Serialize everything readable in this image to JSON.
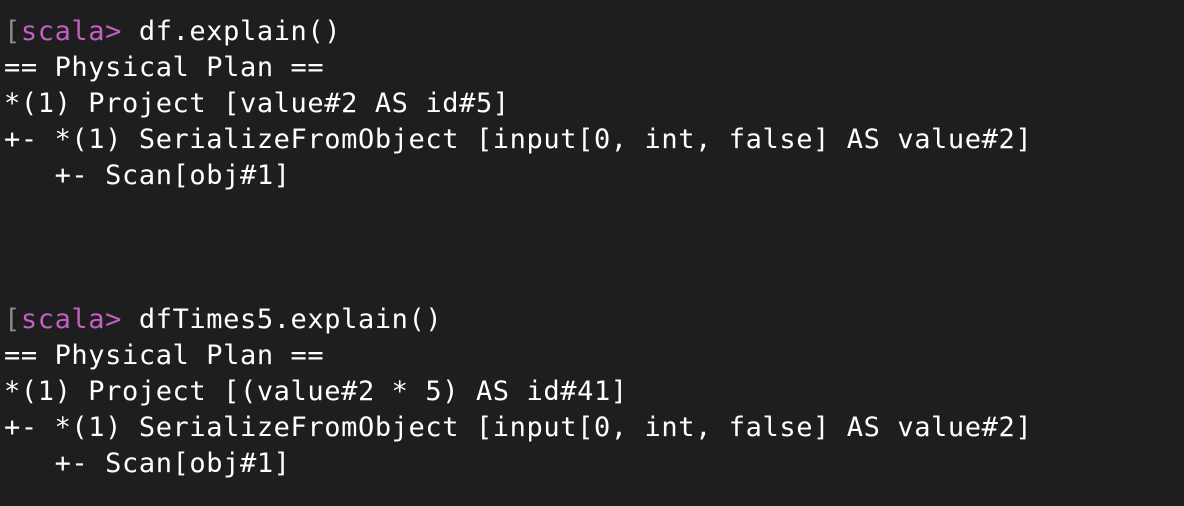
{
  "terminal": {
    "block1": {
      "prompt_bracket": "[",
      "prompt": "scala>",
      "command": " df.explain()",
      "output": [
        "== Physical Plan ==",
        "*(1) Project [value#2 AS id#5]",
        "+- *(1) SerializeFromObject [input[0, int, false] AS value#2]",
        "   +- Scan[obj#1]"
      ]
    },
    "block2": {
      "prompt_bracket": "[",
      "prompt": "scala>",
      "command": " dfTimes5.explain()",
      "output": [
        "== Physical Plan ==",
        "*(1) Project [(value#2 * 5) AS id#41]",
        "+- *(1) SerializeFromObject [input[0, int, false] AS value#2]",
        "   +- Scan[obj#1]"
      ]
    },
    "colors": {
      "background": "#1e1e1e",
      "text": "#ffffff",
      "prompt": "#c45fc4",
      "bracket": "#8a8a8a"
    }
  }
}
